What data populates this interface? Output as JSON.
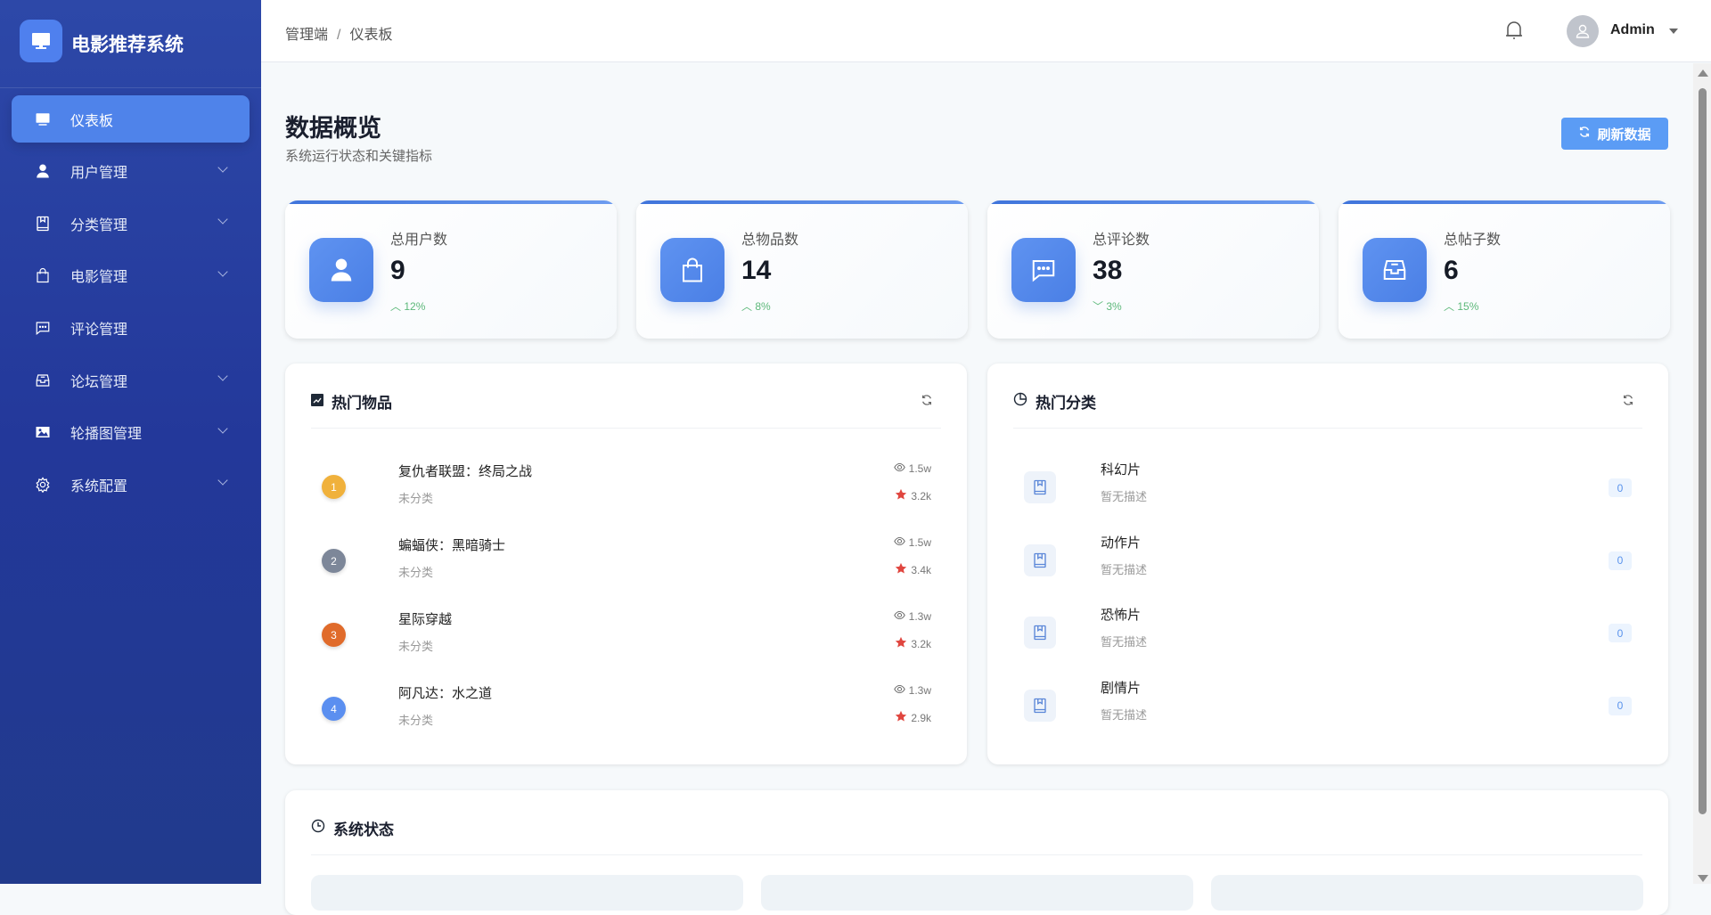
{
  "brand": {
    "title": "电影推荐系统",
    "icon": "monitor-icon"
  },
  "sidebar": {
    "items": [
      {
        "label": "仪表板",
        "icon": "monitor-icon",
        "active": true,
        "expandable": false
      },
      {
        "label": "用户管理",
        "icon": "user-icon",
        "expandable": true
      },
      {
        "label": "分类管理",
        "icon": "book-icon",
        "expandable": true
      },
      {
        "label": "电影管理",
        "icon": "bag-icon",
        "expandable": true
      },
      {
        "label": "评论管理",
        "icon": "comment-icon",
        "expandable": false
      },
      {
        "label": "论坛管理",
        "icon": "inbox-icon",
        "expandable": true
      },
      {
        "label": "轮播图管理",
        "icon": "image-icon",
        "expandable": true
      },
      {
        "label": "系统配置",
        "icon": "gear-icon",
        "expandable": true
      }
    ]
  },
  "header": {
    "breadcrumb": [
      "管理端",
      "仪表板"
    ],
    "separator": "/",
    "user": "Admin"
  },
  "page": {
    "title": "数据概览",
    "subtitle": "系统运行状态和关键指标",
    "refresh_label": "刷新数据"
  },
  "stats": [
    {
      "label": "总用户数",
      "value": "9",
      "trend": "12%",
      "dir": "up",
      "icon": "user-icon"
    },
    {
      "label": "总物品数",
      "value": "14",
      "trend": "8%",
      "dir": "up",
      "icon": "bag-icon"
    },
    {
      "label": "总评论数",
      "value": "38",
      "trend": "3%",
      "dir": "down",
      "icon": "comment-icon"
    },
    {
      "label": "总帖子数",
      "value": "6",
      "trend": "15%",
      "dir": "up",
      "icon": "inbox-icon"
    }
  ],
  "hot_items": {
    "title": "热门物品",
    "items": [
      {
        "rank": "1",
        "name": "复仇者联盟：终局之战",
        "category": "未分类",
        "views": "1.5w",
        "likes": "3.2k",
        "color": "#f0b13c"
      },
      {
        "rank": "2",
        "name": "蝙蝠侠：黑暗骑士",
        "category": "未分类",
        "views": "1.5w",
        "likes": "3.4k",
        "color": "#7d8799"
      },
      {
        "rank": "3",
        "name": "星际穿越",
        "category": "未分类",
        "views": "1.3w",
        "likes": "3.2k",
        "color": "#e06b2b"
      },
      {
        "rank": "4",
        "name": "阿凡达：水之道",
        "category": "未分类",
        "views": "1.3w",
        "likes": "2.9k",
        "color": "#5b8ff0"
      }
    ]
  },
  "hot_categories": {
    "title": "热门分类",
    "items": [
      {
        "name": "科幻片",
        "desc": "暂无描述",
        "count": "0"
      },
      {
        "name": "动作片",
        "desc": "暂无描述",
        "count": "0"
      },
      {
        "name": "恐怖片",
        "desc": "暂无描述",
        "count": "0"
      },
      {
        "name": "剧情片",
        "desc": "暂无描述",
        "count": "0"
      }
    ]
  },
  "system_status": {
    "title": "系统状态"
  },
  "colors": {
    "sidebar": "#23389a",
    "accent": "#4f83ea",
    "up": "#5cb87a",
    "star": "#e0463f"
  }
}
